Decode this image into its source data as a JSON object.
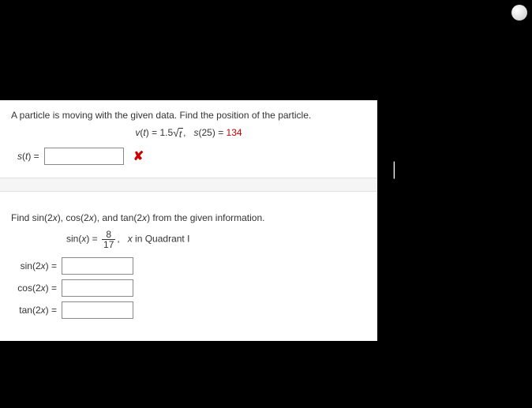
{
  "q1": {
    "prompt": "A particle is moving with the given data. Find the position of the particle.",
    "v_lhs": "v",
    "v_arg": "t",
    "v_coeff": "1.5",
    "v_sqrt_arg": "t",
    "s_cond_lhs": "s",
    "s_cond_arg": "25",
    "s_cond_val": "134",
    "answer_lhs": "s",
    "answer_arg": "t",
    "input_value": ""
  },
  "q2": {
    "prompt_pre": "Find sin(2",
    "prompt_var1": "x",
    "prompt_mid1": "), cos(2",
    "prompt_var2": "x",
    "prompt_mid2": "), and tan(2",
    "prompt_var3": "x",
    "prompt_post": ") from the given information.",
    "given_fn": "sin",
    "given_arg": "x",
    "frac_num": "8",
    "frac_den": "17",
    "quadrant_pre": "x",
    "quadrant_text": " in Quadrant I",
    "row1_fn": "sin",
    "row1_arg": "x",
    "row2_fn": "cos",
    "row2_arg": "x",
    "row3_fn": "tan",
    "row3_arg": "x",
    "input1": "",
    "input2": "",
    "input3": ""
  }
}
